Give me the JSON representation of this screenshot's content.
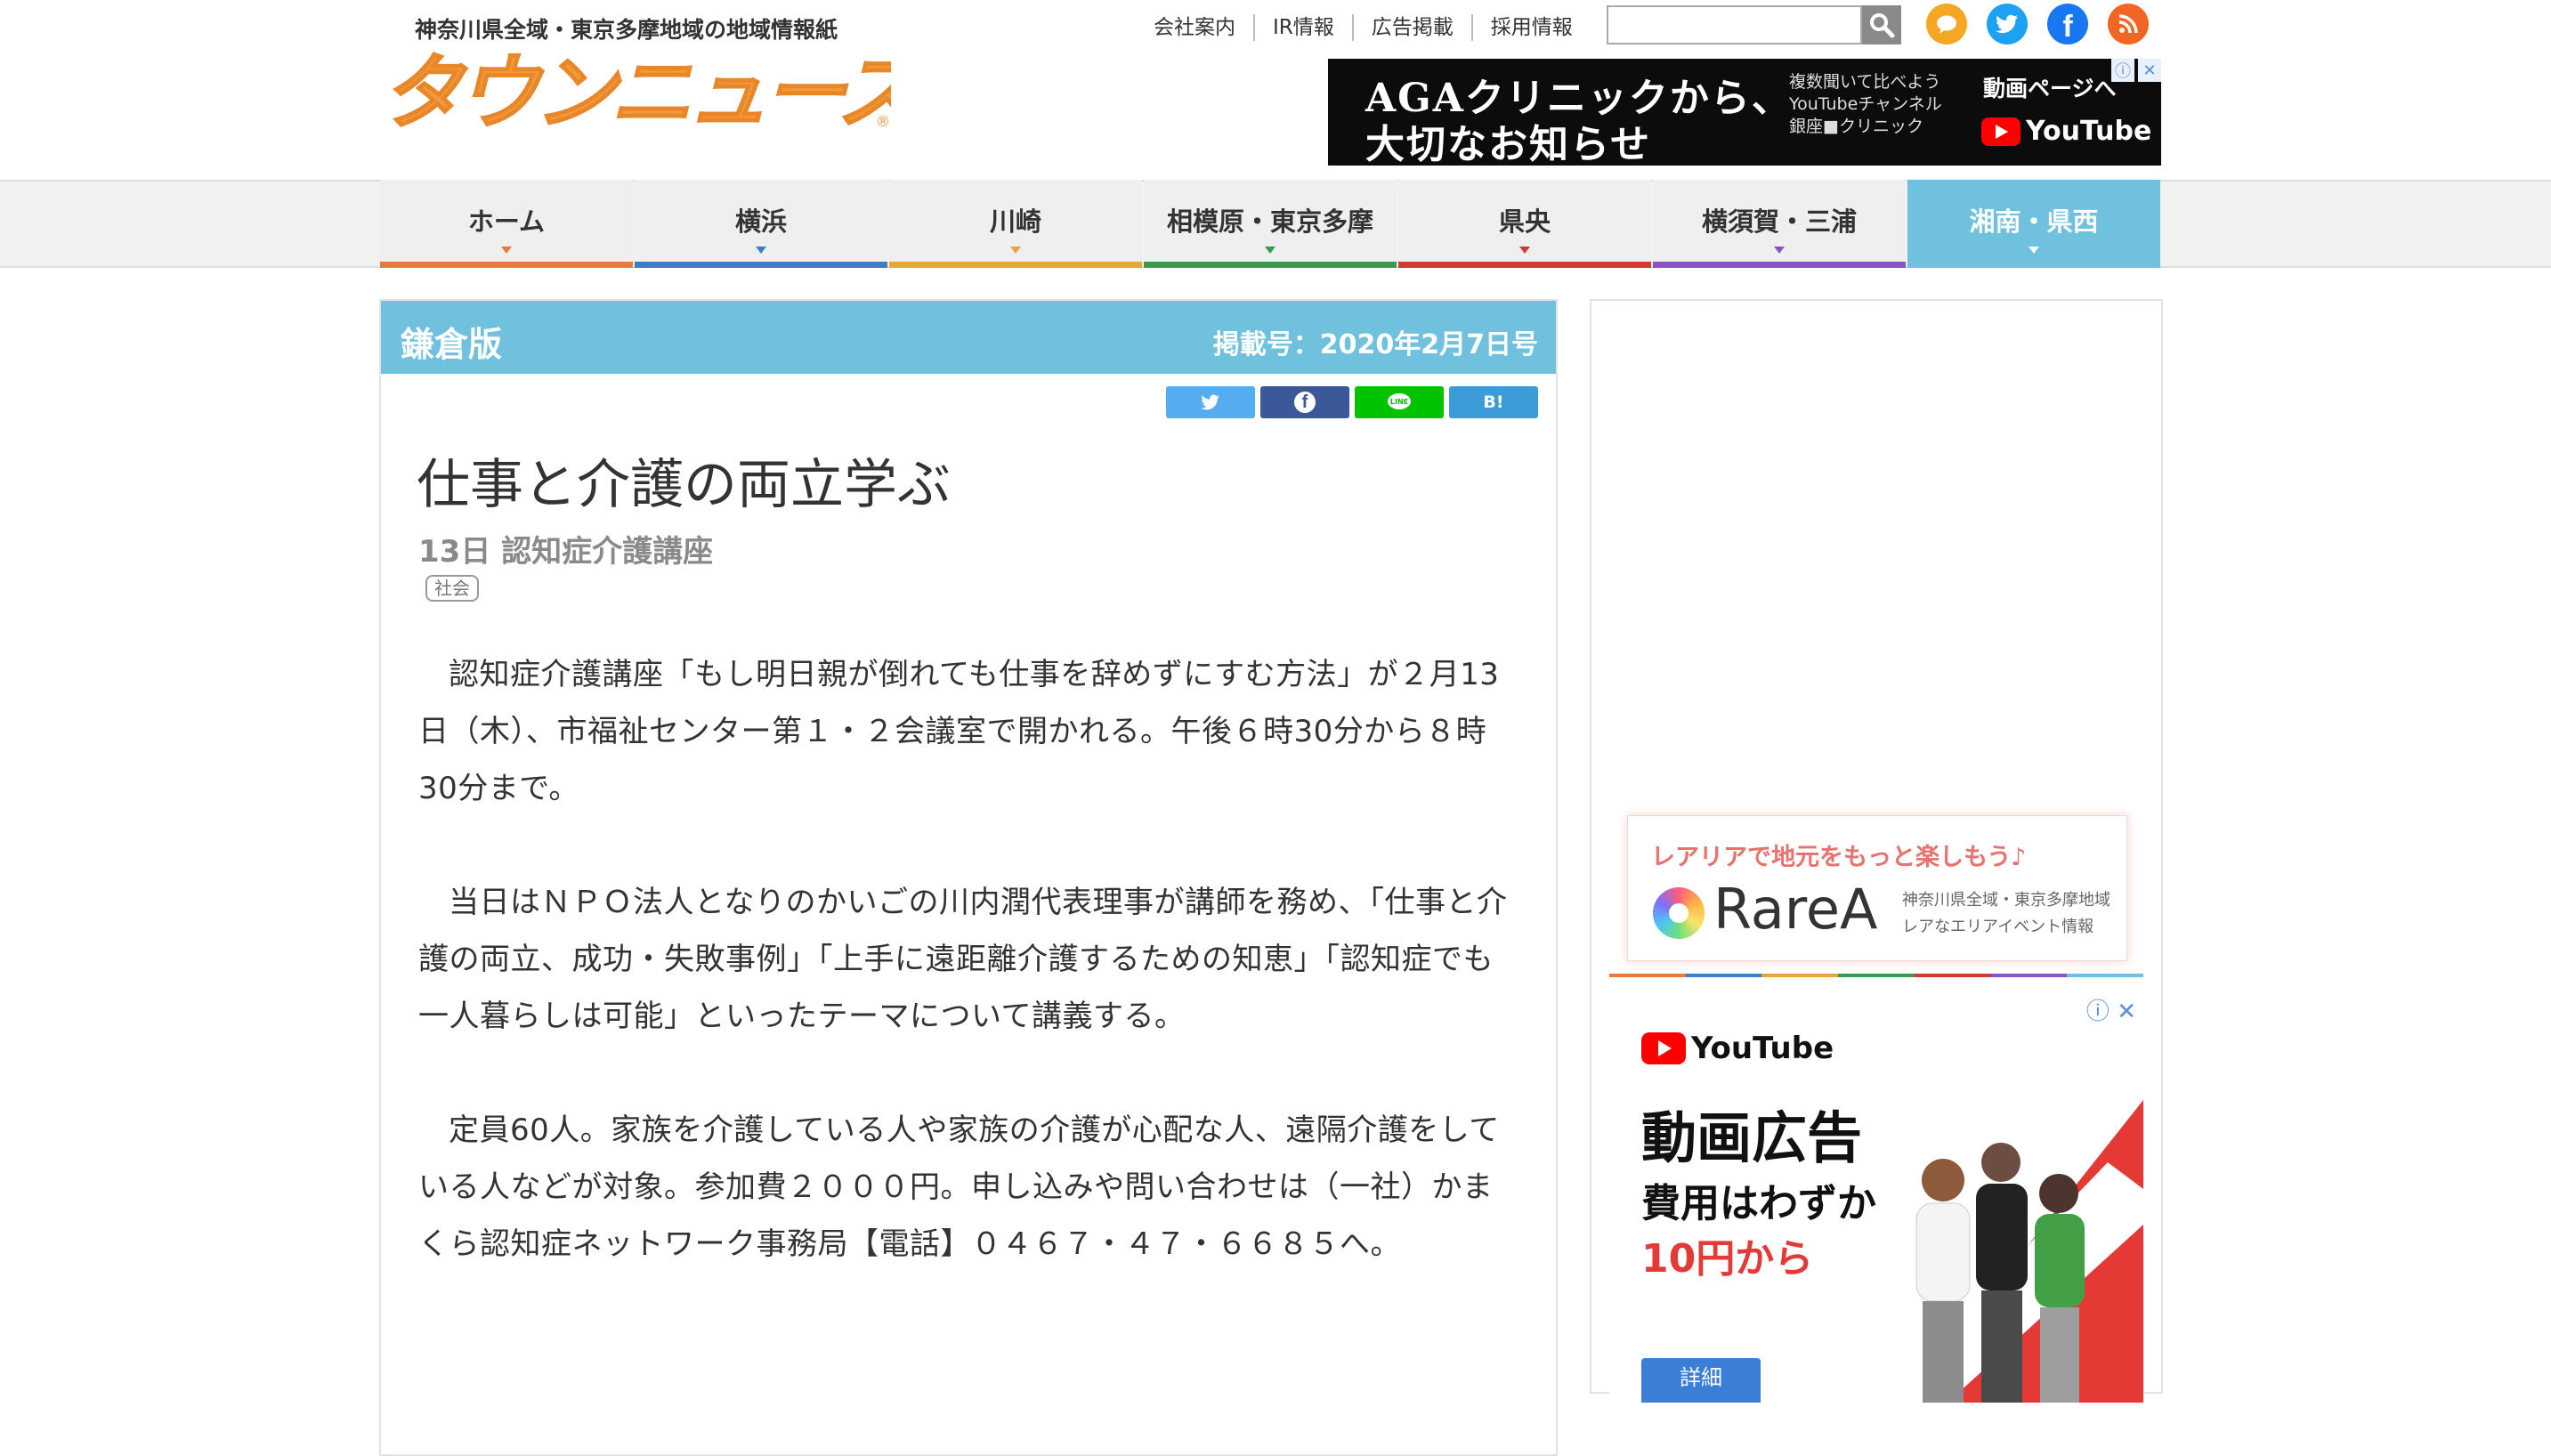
{
  "header": {
    "tagline": "神奈川県全域・東京多摩地域の地域情報紙",
    "logo_text": "タウンニュース",
    "links": [
      "会社案内",
      "IR情報",
      "広告掲載",
      "採用情報"
    ],
    "search_placeholder": ""
  },
  "top_ad": {
    "line1": "AGAクリニックから、",
    "line2": "大切なお知らせ",
    "side_line1": "複数聞いて比べよう",
    "side_line2": "YouTubeチャンネル",
    "side_line3": "銀座■クリニック",
    "cta": "動画ページへ",
    "yt_label": "YouTube"
  },
  "nav": {
    "items": [
      {
        "label": "ホーム",
        "color": "#e57c39"
      },
      {
        "label": "横浜",
        "color": "#3c7cc9"
      },
      {
        "label": "川崎",
        "color": "#e7a63b"
      },
      {
        "label": "相模原・東京多摩",
        "color": "#3b9a4b"
      },
      {
        "label": "県央",
        "color": "#d13a2c"
      },
      {
        "label": "横須賀・三浦",
        "color": "#8a54c7"
      },
      {
        "label": "湘南・県西",
        "color": "#6fc1dd"
      }
    ],
    "active_index": 6
  },
  "article": {
    "edition": "鎌倉版",
    "issue_date": "掲載号：2020年2月7日号",
    "share_buttons": [
      "twitter",
      "facebook",
      "line",
      "B!"
    ],
    "title": "仕事と介護の両立学ぶ",
    "subtitle": "13日 認知症介護講座",
    "tag": "社会",
    "paragraphs": [
      "認知症介護講座「もし明日親が倒れても仕事を辞めずにすむ方法」が２月13日（木）、市福祉センター第１・２会議室で開かれる。午後６時30分から８時30分まで。",
      "当日はＮＰＯ法人となりのかいごの川内潤代表理事が講師を務め、「仕事と介護の両立、成功・失敗事例」「上手に遠距離介護するための知恵」「認知症でも一人暮らしは可能」といったテーマについて講義する。",
      "定員60人。家族を介護している人や家族の介護が心配な人、遠隔介護をしている人などが対象。参加費２０００円。申し込みや問い合わせは（一社）かまくら認知症ネットワーク事務局【電話】０４６７・４７・６６８５へ。"
    ]
  },
  "sidebar": {
    "rarea_tagline": "レアリアで地元をもっと楽しもう♪",
    "rarea_wordmark": "RareA",
    "rarea_small1": "神奈川県全域・東京多摩地域",
    "rarea_small2": "レアなエリアイベント情報",
    "ad_yt": "YouTube",
    "ad_headline": "動画広告",
    "ad_line2": "費用はわずか",
    "ad_line3": "10円から",
    "ad_button": "詳細"
  }
}
